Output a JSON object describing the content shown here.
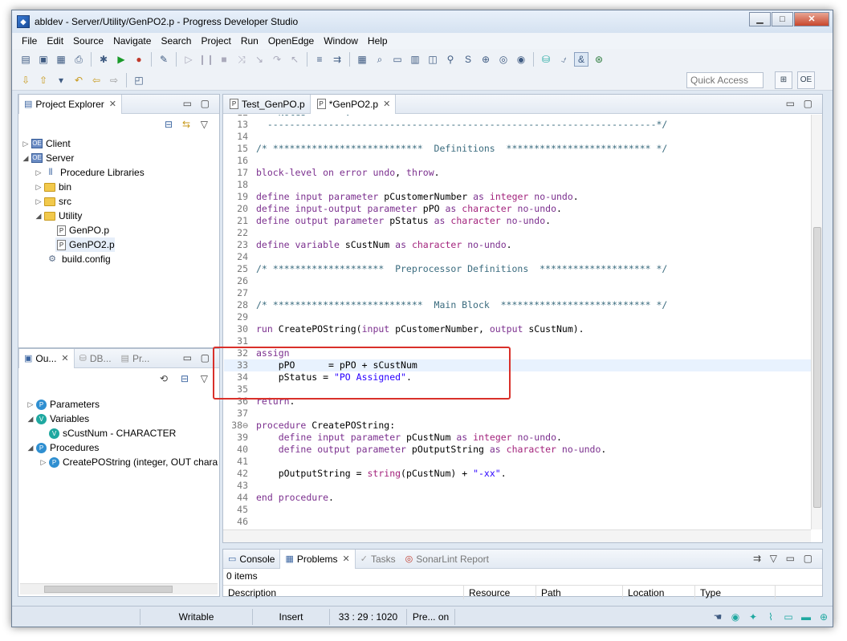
{
  "window": {
    "title": "abldev - Server/Utility/GenPO2.p - Progress Developer Studio"
  },
  "menu": [
    "File",
    "Edit",
    "Source",
    "Navigate",
    "Search",
    "Project",
    "Run",
    "OpenEdge",
    "Window",
    "Help"
  ],
  "toolbar": {
    "quick_access_placeholder": "Quick Access"
  },
  "project_explorer": {
    "title": "Project Explorer",
    "items": [
      {
        "label": "Client",
        "icon": "project-icon",
        "expander": "▷"
      },
      {
        "label": "Server",
        "icon": "project-icon",
        "expander": "◢"
      },
      {
        "label": "Procedure Libraries",
        "icon": "library-icon",
        "expander": "▷"
      },
      {
        "label": "bin",
        "icon": "folder-icon",
        "expander": "▷"
      },
      {
        "label": "src",
        "icon": "folder-icon",
        "expander": "▷"
      },
      {
        "label": "Utility",
        "icon": "folder-icon",
        "expander": "◢"
      },
      {
        "label": "GenPO.p",
        "icon": "procedure-file-icon",
        "expander": ""
      },
      {
        "label": "GenPO2.p",
        "icon": "procedure-file-icon",
        "expander": ""
      },
      {
        "label": "build.config",
        "icon": "config-file-icon",
        "expander": ""
      }
    ]
  },
  "outline": {
    "tabs": [
      "Ou...",
      "DB...",
      "Pr..."
    ],
    "items": [
      {
        "label": "Parameters",
        "icon": "parameters-icon",
        "expander": "▷"
      },
      {
        "label": "Variables",
        "icon": "variables-icon",
        "expander": "◢"
      },
      {
        "label": "sCustNum - CHARACTER",
        "icon": "variable-icon",
        "expander": ""
      },
      {
        "label": "Procedures",
        "icon": "procedures-icon",
        "expander": "◢"
      },
      {
        "label": "CreatePOString (integer, OUT chara",
        "icon": "procedure-icon",
        "expander": "▷"
      }
    ]
  },
  "editor": {
    "tabs": [
      {
        "label": "Test_GenPO.p",
        "active": false
      },
      {
        "label": "*GenPO2.p",
        "active": true
      }
    ],
    "current_line": 33,
    "lines": [
      {
        "n": "12",
        "t": "    Notes       :"
      },
      {
        "n": "13",
        "t": "  ----------------------------------------------------------------------*/"
      },
      {
        "n": "14",
        "t": ""
      },
      {
        "n": "15",
        "t": "/* ***************************  Definitions  ************************** */"
      },
      {
        "n": "16",
        "t": ""
      },
      {
        "n": "17",
        "t": "block-level on error undo, throw."
      },
      {
        "n": "18",
        "t": ""
      },
      {
        "n": "19",
        "t": "define input parameter pCustomerNumber as integer no-undo."
      },
      {
        "n": "20",
        "t": "define input-output parameter pPO as character no-undo."
      },
      {
        "n": "21",
        "t": "define output parameter pStatus as character no-undo."
      },
      {
        "n": "22",
        "t": ""
      },
      {
        "n": "23",
        "t": "define variable sCustNum as character no-undo."
      },
      {
        "n": "24",
        "t": ""
      },
      {
        "n": "25",
        "t": "/* ********************  Preprocessor Definitions  ******************** */"
      },
      {
        "n": "26",
        "t": ""
      },
      {
        "n": "27",
        "t": ""
      },
      {
        "n": "28",
        "t": "/* ***************************  Main Block  *************************** */"
      },
      {
        "n": "29",
        "t": ""
      },
      {
        "n": "30",
        "t": "run CreatePOString(input pCustomerNumber, output sCustNum)."
      },
      {
        "n": "31",
        "t": ""
      },
      {
        "n": "32",
        "t": "assign"
      },
      {
        "n": "33",
        "t": "    pPO      = pPO + sCustNum"
      },
      {
        "n": "34",
        "t": "    pStatus = \"PO Assigned\"."
      },
      {
        "n": "35",
        "t": ""
      },
      {
        "n": "36",
        "t": "return."
      },
      {
        "n": "37",
        "t": ""
      },
      {
        "n": "38⊖",
        "t": "procedure CreatePOString:"
      },
      {
        "n": "39",
        "t": "    define input parameter pCustNum as integer no-undo."
      },
      {
        "n": "40",
        "t": "    define output parameter pOutputString as character no-undo."
      },
      {
        "n": "41",
        "t": ""
      },
      {
        "n": "42",
        "t": "    pOutputString = string(pCustNum) + \"-xx\"."
      },
      {
        "n": "43",
        "t": ""
      },
      {
        "n": "44",
        "t": "end procedure."
      },
      {
        "n": "45",
        "t": ""
      },
      {
        "n": "46",
        "t": ""
      }
    ]
  },
  "bottom": {
    "tabs": [
      {
        "label": "Console",
        "active": false
      },
      {
        "label": "Problems",
        "active": true
      },
      {
        "label": "Tasks",
        "active": false
      },
      {
        "label": "SonarLint Report",
        "active": false
      }
    ],
    "items_count": "0 items",
    "columns": [
      "Description",
      "Resource",
      "Path",
      "Location",
      "Type"
    ]
  },
  "statusbar": {
    "mode": "Writable",
    "insert": "Insert",
    "position": "33 : 29 : 1020",
    "progress": "Pre... on"
  },
  "colors": {
    "highlight": "#d9302a",
    "keyword": "#7b2f8e",
    "comment": "#3a6b7e",
    "string": "#2a00ff"
  }
}
